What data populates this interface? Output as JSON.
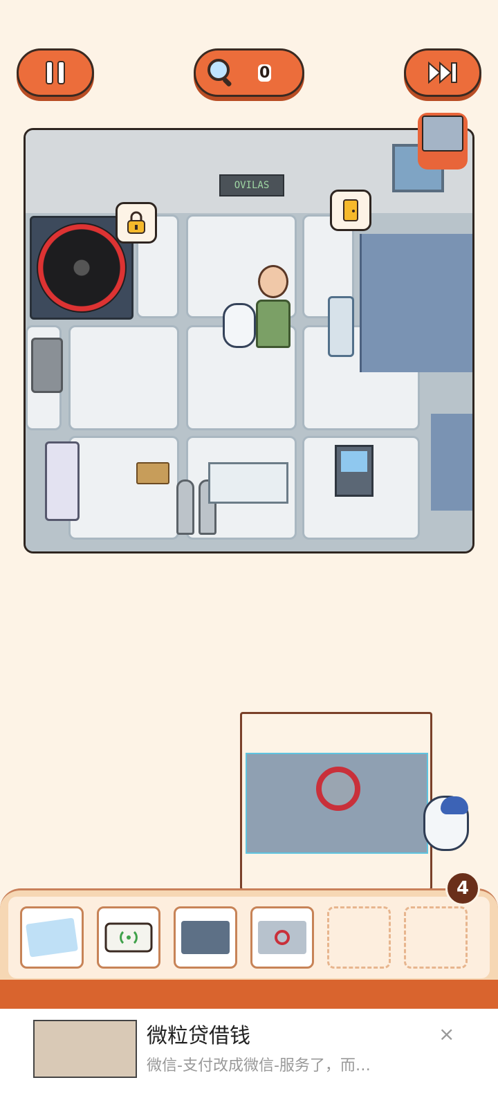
{
  "header": {
    "hint_count": "0"
  },
  "icons": {
    "pause": "pause-icon",
    "hint": "magnifier-icon",
    "skip": "fast-forward-icon",
    "lock": "lock-icon",
    "door": "door-icon"
  },
  "scene": {
    "sign_text": "OVILAS"
  },
  "inventory": {
    "count": "4",
    "slots": [
      {
        "item": "map-card",
        "filled": true
      },
      {
        "item": "signal-device",
        "filled": true
      },
      {
        "item": "panel-photo",
        "filled": true
      },
      {
        "item": "vault-lock-photo",
        "filled": true,
        "selected": true
      },
      {
        "item": "",
        "filled": false
      },
      {
        "item": "",
        "filled": false
      }
    ]
  },
  "ad": {
    "title": "微粒贷借钱",
    "subtitle": "微信-支付改成微信-服务了，而…",
    "close_label": "×"
  },
  "colors": {
    "accent": "#ec6d3b",
    "background": "#fdf3e6",
    "border": "#3a2a22"
  }
}
